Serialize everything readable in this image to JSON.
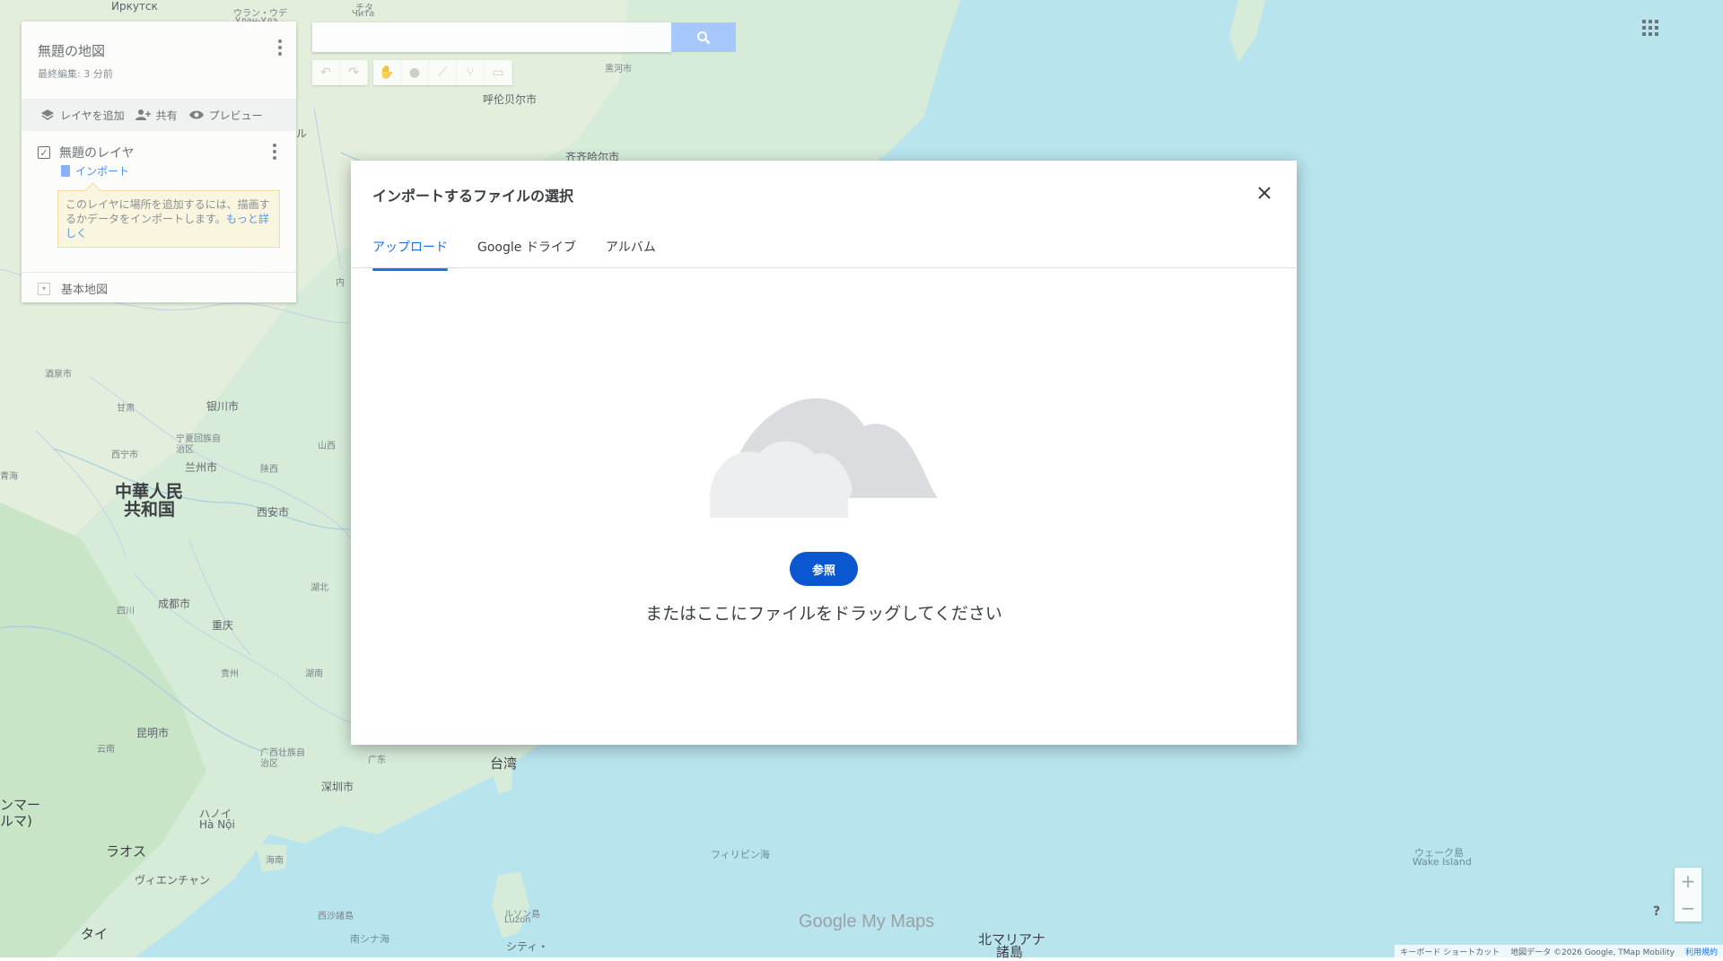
{
  "panel": {
    "map_title": "無題の地図",
    "last_edited": "最終編集: 3 分前",
    "actions": {
      "add_layer": "レイヤを追加",
      "share": "共有",
      "preview": "プレビュー"
    },
    "layer_name": "無題のレイヤ",
    "import_label": "インポート",
    "hint_text": "このレイヤに場所を追加するには、描画するかデータをインポートします。",
    "hint_more": "もっと詳しく",
    "basemap_label": "基本地図"
  },
  "search": {
    "placeholder": ""
  },
  "modal": {
    "title": "インポートするファイルの選択",
    "tabs": [
      {
        "label": "アップロード",
        "active": true
      },
      {
        "label": "Google ドライブ",
        "active": false
      },
      {
        "label": "アルバム",
        "active": false
      }
    ],
    "browse_label": "参照",
    "drag_text": "またはここにファイルをドラッグしてください"
  },
  "map_labels": {
    "irkutsk": "Иркутск",
    "ulanude": "ウラン・ウデ",
    "ulanude_ru": "Улан-Удэ",
    "chita": "チタ",
    "chita_ru": "Чита",
    "hulunbuir": "呼伦贝尔市",
    "heihe": "黑河市",
    "qiqihar": "齐齐哈尔市",
    "inner": "内",
    "ru": "ル",
    "xining_area": "西宁市",
    "lanzhou": "兰州市",
    "yinchuan": "银川市",
    "ningxia": "宁夏回族自治区",
    "gansu": "甘肃",
    "qinghai": "青海",
    "shanxi": "陕西",
    "shanxi2": "山西",
    "prc_line1": "中華人民",
    "prc_line2": "共和国",
    "xian": "西安市",
    "chengdu": "成都市",
    "chongqing": "重庆",
    "sichuan": "四川",
    "hubei": "湖北",
    "hunan": "湖南",
    "guizhou": "贵州",
    "kunming": "昆明市",
    "yunnan": "云南",
    "guangxi": "广西壮族自治区",
    "guangdong": "广东",
    "shenzhen": "深圳市",
    "taiwan": "台湾",
    "hanoi": "ハノイ",
    "hanoi_vi": "Hà Nội",
    "laos": "ラオス",
    "vientiane": "ヴィエンチャン",
    "myanmar1": "ンマー",
    "myanmar2": "ルマ)",
    "hainan": "海南",
    "thai": "タイ",
    "philippine_sea": "フィリピン海",
    "luzon": "ルソン島",
    "luzon_en": "Luzon",
    "wake": "ウェーク島",
    "wake_en": "Wake Island",
    "marianas1": "北マリアナ",
    "marianas2": "諸島",
    "south_china_sea": "南シナ海",
    "paracel": "西沙諸島",
    "manila": "シティ・",
    "jiuquan": "酒泉市"
  },
  "logo": {
    "google": "Google",
    "mymaps": "My Maps"
  },
  "footer": {
    "shortcuts": "キーボード ショートカット",
    "map_data": "地図データ ©2026 Google, TMap Mobility",
    "terms": "利用規約"
  },
  "controls": {
    "help": "?",
    "zoom_in": "+",
    "zoom_out": "−"
  }
}
